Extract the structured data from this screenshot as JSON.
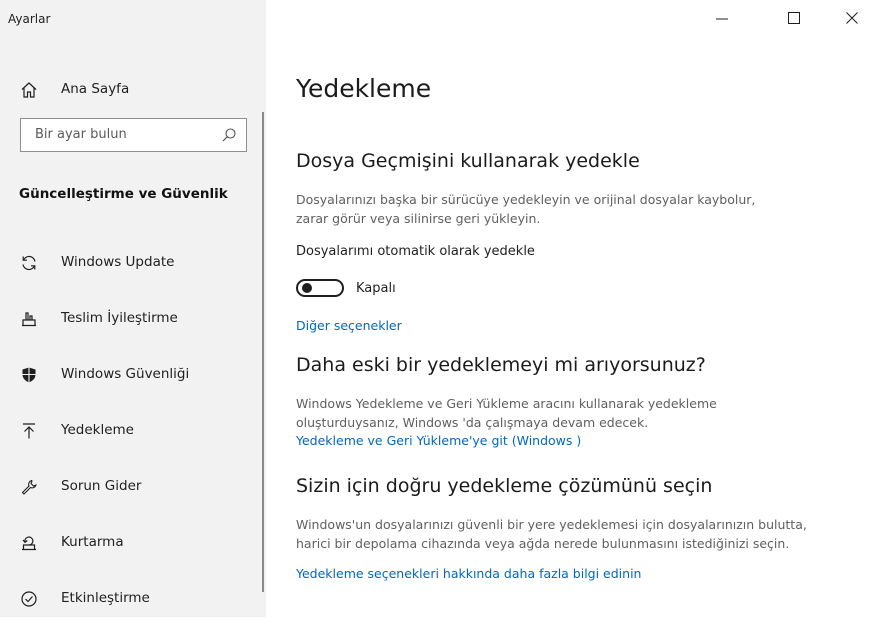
{
  "app": {
    "title": "Ayarlar"
  },
  "window_controls": {
    "minimize": "minimize",
    "maximize": "maximize",
    "close": "close"
  },
  "sidebar": {
    "home_label": "Ana Sayfa",
    "search_placeholder": "Bir ayar bulun",
    "section_heading": "Güncelleştirme ve Güvenlik",
    "items": [
      {
        "label": "Windows Update",
        "icon": "refresh-icon"
      },
      {
        "label": "Teslim İyileştirme",
        "icon": "delivery-optimization-icon"
      },
      {
        "label": "Windows Güvenliği",
        "icon": "shield-icon"
      },
      {
        "label": "Yedekleme",
        "icon": "backup-arrow-icon"
      },
      {
        "label": "Sorun Gider",
        "icon": "wrench-icon"
      },
      {
        "label": "Kurtarma",
        "icon": "recovery-icon"
      },
      {
        "label": "Etkinleştirme",
        "icon": "check-circle-icon"
      }
    ]
  },
  "main": {
    "title": "Yedekleme",
    "file_history": {
      "heading": "Dosya Geçmişini kullanarak yedekle",
      "desc_line1": "Dosyalarınızı başka bir sürücüye yedekleyin ve orijinal dosyalar kaybolur,",
      "desc_line2": "zarar görür veya silinirse geri yükleyin.",
      "auto_backup_label": "Dosyalarımı otomatik olarak yedekle",
      "toggle_state": "Kapalı",
      "more_options": "Diğer seçenekler"
    },
    "older_backup": {
      "heading": "Daha eski bir yedeklemeyi mi arıyorsunuz?",
      "desc_line1": "Windows    Yedekleme ve Geri Yükleme aracını kullanarak yedekleme",
      "desc_line2": "oluşturduysanız, Windows 'da  çalışmaya devam edecek.",
      "link": "Yedekleme ve Geri Yükleme'ye git (Windows )"
    },
    "choose_solution": {
      "heading": "Sizin için doğru yedekleme çözümünü seçin",
      "desc_line1": "Windows'un dosyalarınızı güvenli bir yere yedeklemesi için dosyalarınızın bulutta,",
      "desc_line2": "harici bir depolama cihazında veya ağda nerede bulunmasını istediğinizi seçin.",
      "link": "Yedekleme seçenekleri hakkında daha fazla bilgi edinin"
    }
  },
  "colors": {
    "sidebar_bg": "#f2f2f2",
    "link": "#0067c0",
    "text": "#1f1f1f",
    "secondary_text": "#5f5f5f"
  }
}
